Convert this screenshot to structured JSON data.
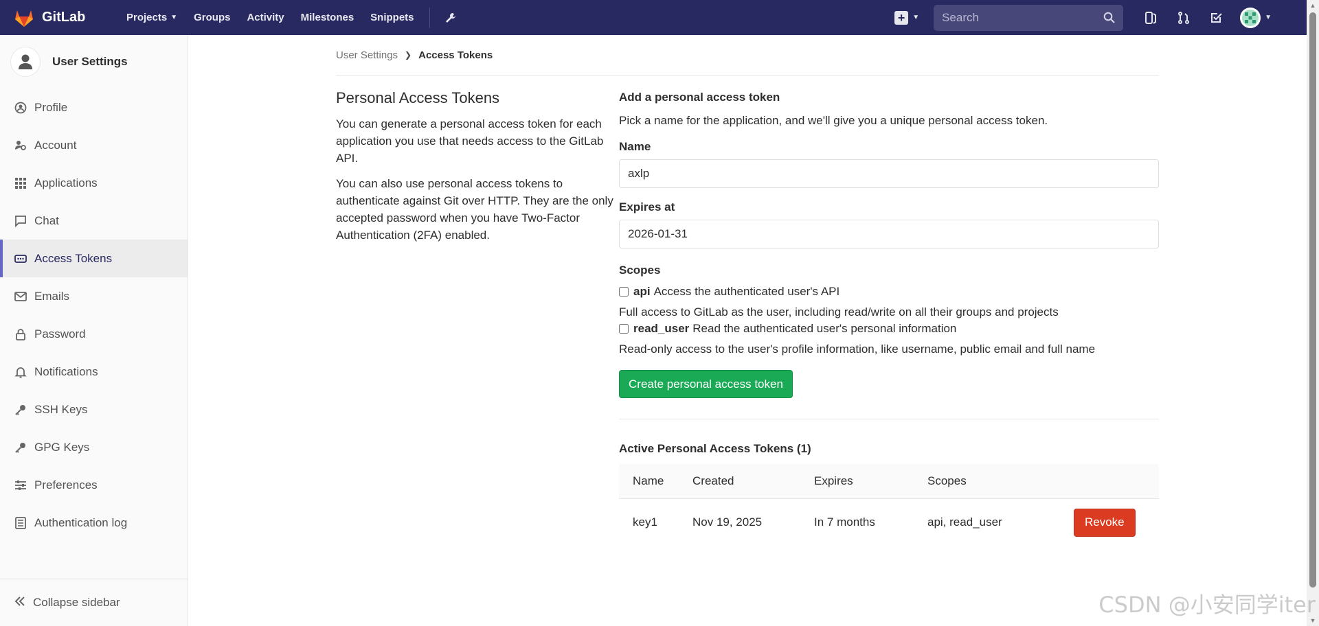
{
  "navbar": {
    "brand": "GitLab",
    "links": [
      "Projects",
      "Groups",
      "Activity",
      "Milestones",
      "Snippets"
    ],
    "search_placeholder": "Search",
    "colors": {
      "bg": "#292961",
      "logo": "#fc6d26"
    }
  },
  "sidebar": {
    "title": "User Settings",
    "items": [
      {
        "label": "Profile",
        "icon": "profile-icon"
      },
      {
        "label": "Account",
        "icon": "account-icon"
      },
      {
        "label": "Applications",
        "icon": "applications-icon"
      },
      {
        "label": "Chat",
        "icon": "chat-icon"
      },
      {
        "label": "Access Tokens",
        "icon": "token-icon",
        "active": true
      },
      {
        "label": "Emails",
        "icon": "mail-icon"
      },
      {
        "label": "Password",
        "icon": "lock-icon"
      },
      {
        "label": "Notifications",
        "icon": "bell-icon"
      },
      {
        "label": "SSH Keys",
        "icon": "key-icon"
      },
      {
        "label": "GPG Keys",
        "icon": "key-icon"
      },
      {
        "label": "Preferences",
        "icon": "sliders-icon"
      },
      {
        "label": "Authentication log",
        "icon": "log-icon"
      }
    ],
    "collapse_label": "Collapse sidebar"
  },
  "breadcrumb": {
    "parent": "User Settings",
    "current": "Access Tokens"
  },
  "intro": {
    "title": "Personal Access Tokens",
    "p1": "You can generate a personal access token for each application you use that needs access to the GitLab API.",
    "p2": "You can also use personal access tokens to authenticate against Git over HTTP. They are the only accepted password when you have Two-Factor Authentication (2FA) enabled."
  },
  "form": {
    "title": "Add a personal access token",
    "description": "Pick a name for the application, and we'll give you a unique personal access token.",
    "name_label": "Name",
    "name_value": "axlp",
    "expires_label": "Expires at",
    "expires_value": "2026-01-31",
    "scopes_label": "Scopes",
    "scopes": [
      {
        "name": "api",
        "desc": "Access the authenticated user's API",
        "help": "Full access to GitLab as the user, including read/write on all their groups and projects",
        "checked": false
      },
      {
        "name": "read_user",
        "desc": "Read the authenticated user's personal information",
        "help": "Read-only access to the user's profile information, like username, public email and full name",
        "checked": false
      }
    ],
    "submit_label": "Create personal access token"
  },
  "active_tokens": {
    "title": "Active Personal Access Tokens (1)",
    "columns": [
      "Name",
      "Created",
      "Expires",
      "Scopes"
    ],
    "rows": [
      {
        "name": "key1",
        "created": "Nov 19, 2025",
        "expires": "In 7 months",
        "scopes": "api, read_user",
        "action": "Revoke"
      }
    ]
  },
  "watermark": "CSDN @小安同学iter"
}
